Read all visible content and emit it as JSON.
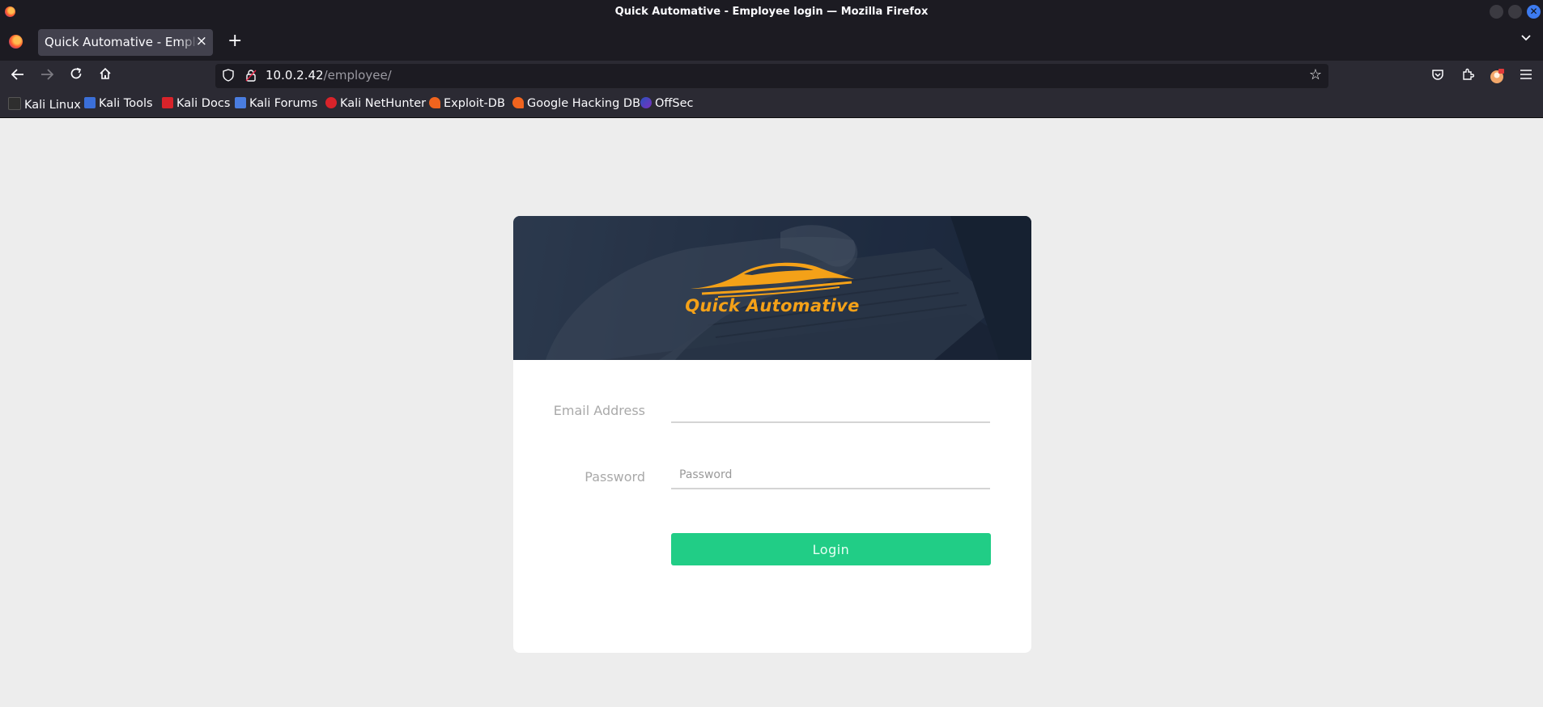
{
  "window": {
    "title": "Quick Automative - Employee login — Mozilla Firefox"
  },
  "tabs": [
    {
      "label": "Quick Automative - Employee login",
      "active": true
    }
  ],
  "navbar": {
    "url_host": "10.0.2.42",
    "url_path": "/employee/"
  },
  "bookmarks": [
    {
      "label": "Kali Linux",
      "icon": "kali-dragon-icon"
    },
    {
      "label": "Kali Tools",
      "icon": "kali-tools-icon"
    },
    {
      "label": "Kali Docs",
      "icon": "kali-docs-icon"
    },
    {
      "label": "Kali Forums",
      "icon": "kali-forums-icon"
    },
    {
      "label": "Kali NetHunter",
      "icon": "kali-nethunter-icon"
    },
    {
      "label": "Exploit-DB",
      "icon": "exploit-db-icon"
    },
    {
      "label": "Google Hacking DB",
      "icon": "ghdb-icon"
    },
    {
      "label": "OffSec",
      "icon": "offsec-icon"
    }
  ],
  "page": {
    "brand_name": "Quick Automative",
    "email_label": "Email Address",
    "email_value": "",
    "email_placeholder": "",
    "password_label": "Password",
    "password_placeholder": "Password",
    "login_label": "Login"
  },
  "colors": {
    "brand_orange": "#f4a118",
    "login_green": "#21cd86",
    "page_background": "#ededed"
  }
}
